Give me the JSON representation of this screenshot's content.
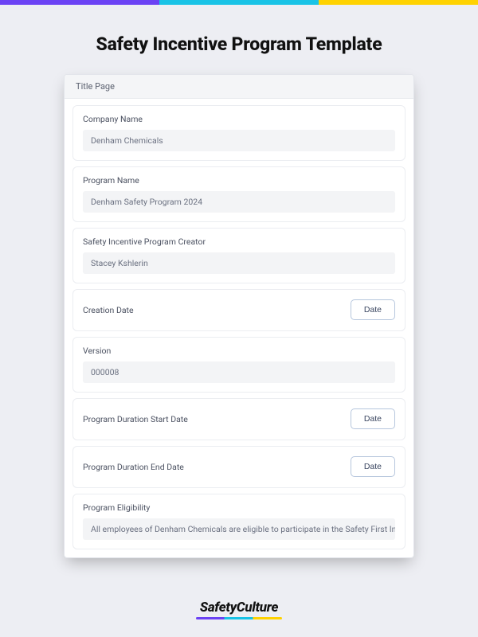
{
  "topBar": {
    "colors": [
      "#6b42f4",
      "#19c3e6",
      "#ffd200"
    ]
  },
  "pageTitle": "Safety Incentive Program Template",
  "sectionHeader": "Title Page",
  "fields": {
    "companyName": {
      "label": "Company Name",
      "value": "Denham Chemicals"
    },
    "programName": {
      "label": "Program Name",
      "value": "Denham Safety Program 2024"
    },
    "creator": {
      "label": "Safety Incentive Program Creator",
      "value": "Stacey Kshlerin"
    },
    "creationDate": {
      "label": "Creation Date",
      "button": "Date"
    },
    "version": {
      "label": "Version",
      "value": "000008"
    },
    "startDate": {
      "label": "Program Duration Start Date",
      "button": "Date"
    },
    "endDate": {
      "label": "Program Duration End Date",
      "button": "Date"
    },
    "eligibility": {
      "label": "Program Eligibility",
      "value": "All employees of Denham Chemicals are eligible to participate in the Safety First Incentive I"
    }
  },
  "brand": "SafetyCulture"
}
